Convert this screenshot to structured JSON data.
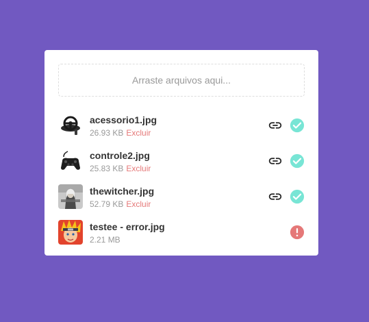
{
  "dropzone": {
    "label": "Arraste arquivos aqui..."
  },
  "files": [
    {
      "name": "acessorio1.jpg",
      "size": "26.93 KB",
      "delete_label": "Excluir",
      "status": "success",
      "thumb_icon": "steering-wheel-icon"
    },
    {
      "name": "controle2.jpg",
      "size": "25.83 KB",
      "delete_label": "Excluir",
      "status": "success",
      "thumb_icon": "gamepad-icon"
    },
    {
      "name": "thewitcher.jpg",
      "size": "52.79 KB",
      "delete_label": "Excluir",
      "status": "success",
      "thumb_icon": "witcher-cover-icon"
    },
    {
      "name": "testee - error.jpg",
      "size": "2.21 MB",
      "status": "error",
      "thumb_icon": "naruto-cover-icon"
    }
  ],
  "colors": {
    "background": "#7159c1",
    "success": "#78e5d5",
    "error": "#e57878",
    "delete": "#e57878"
  }
}
